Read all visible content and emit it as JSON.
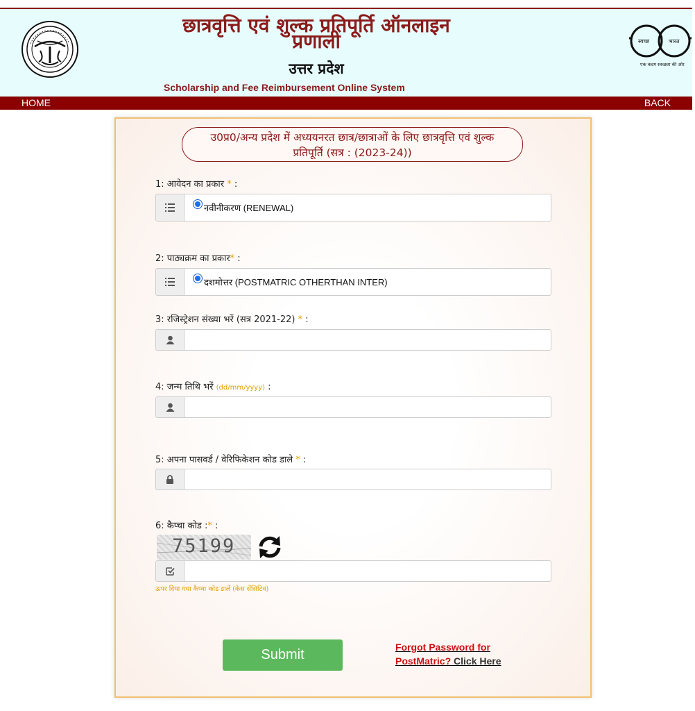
{
  "header": {
    "title_line1": "छात्रवृत्ति एवं शुल्क प्रतिपूर्ति ऑनलाइन",
    "title_line2": "प्रणाली",
    "state": "उत्तर प्रदेश",
    "subtitle": "Scholarship and Fee Reimbursement Online System",
    "emblem_icon": "up-government-emblem-icon",
    "swachh_icon": "swachh-bharat-logo-icon"
  },
  "nav": {
    "home": "HOME",
    "back": "BACK"
  },
  "form": {
    "heading_line1": "उ0प्र0/अन्य प्रदेश में अध्ययनरत छात्र/छात्राओं के लिए छात्रवृत्ति एवं शुल्क",
    "heading_line2": "प्रतिपूर्ति (सत्र : (2023-24))",
    "fields": [
      {
        "label": "1: आवेदन का प्रकार",
        "required": "*",
        "suffix": " :",
        "value": "नवीनीकरण (RENEWAL)",
        "icon": "list-icon"
      },
      {
        "label": "2: पाठ्यक्रम का प्रकार",
        "required": "*",
        "suffix": " :",
        "value": "दशमोत्तर (POSTMATRIC OTHERTHAN INTER)",
        "icon": "list-icon"
      },
      {
        "label": "3: रजिस्ट्रेशन संख्या भरें (सत्र 2021-22)",
        "required": "*",
        "suffix": " :",
        "value": "",
        "icon": "user-icon"
      },
      {
        "label": "4: जन्म तिथि भरें",
        "hint": "(dd/mm/yyyy)",
        "suffix": " :",
        "value": "",
        "icon": "user-icon"
      },
      {
        "label": "5: अपना पासवर्ड / वेरिफिकेशन कोड डाले",
        "required": "*",
        "suffix": " :",
        "value": "",
        "icon": "lock-icon"
      },
      {
        "label": "6: कैप्चा कोड :",
        "required": "*",
        "suffix": " :",
        "value": "",
        "icon": "checkbox-icon"
      }
    ],
    "captcha_code": "75199",
    "captcha_help": "ऊपर दिया गया कैप्चा कोड डालें (केस सेंसिटिव)",
    "submit_label": "Submit",
    "forgot_line1": "Forgot Password for",
    "forgot_line2a": "PostMatric?",
    "forgot_line2b": " Click Here"
  },
  "colors": {
    "brand_maroon": "#8b1a1a",
    "nav_bg": "#8b0000",
    "header_bg": "#e6fcfd",
    "submit_green": "#5cb85c",
    "required_gold": "#e0a000",
    "link_red": "#cc1111"
  }
}
